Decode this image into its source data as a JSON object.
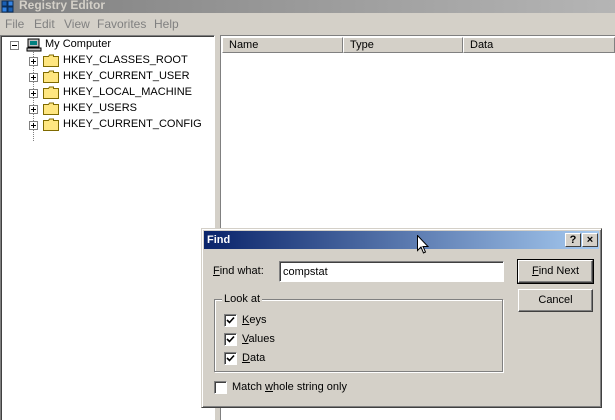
{
  "window": {
    "title": "Registry Editor"
  },
  "menu": [
    "File",
    "Edit",
    "View",
    "Favorites",
    "Help"
  ],
  "tree": {
    "root": "My Computer",
    "children": [
      "HKEY_CLASSES_ROOT",
      "HKEY_CURRENT_USER",
      "HKEY_LOCAL_MACHINE",
      "HKEY_USERS",
      "HKEY_CURRENT_CONFIG"
    ]
  },
  "list": {
    "columns": [
      "Name",
      "Type",
      "Data"
    ]
  },
  "find_dialog": {
    "title": "Find",
    "help_glyph": "?",
    "close_glyph": "×",
    "find_what_label": "Find what:",
    "find_what_value": "compstat",
    "look_at_label": "Look at",
    "options": [
      {
        "label": "Keys",
        "checked": true
      },
      {
        "label": "Values",
        "checked": true
      },
      {
        "label": "Data",
        "checked": true
      }
    ],
    "match_whole_label": "Match whole string only",
    "match_whole_checked": false,
    "find_next_label": "Find Next",
    "cancel_label": "Cancel"
  }
}
